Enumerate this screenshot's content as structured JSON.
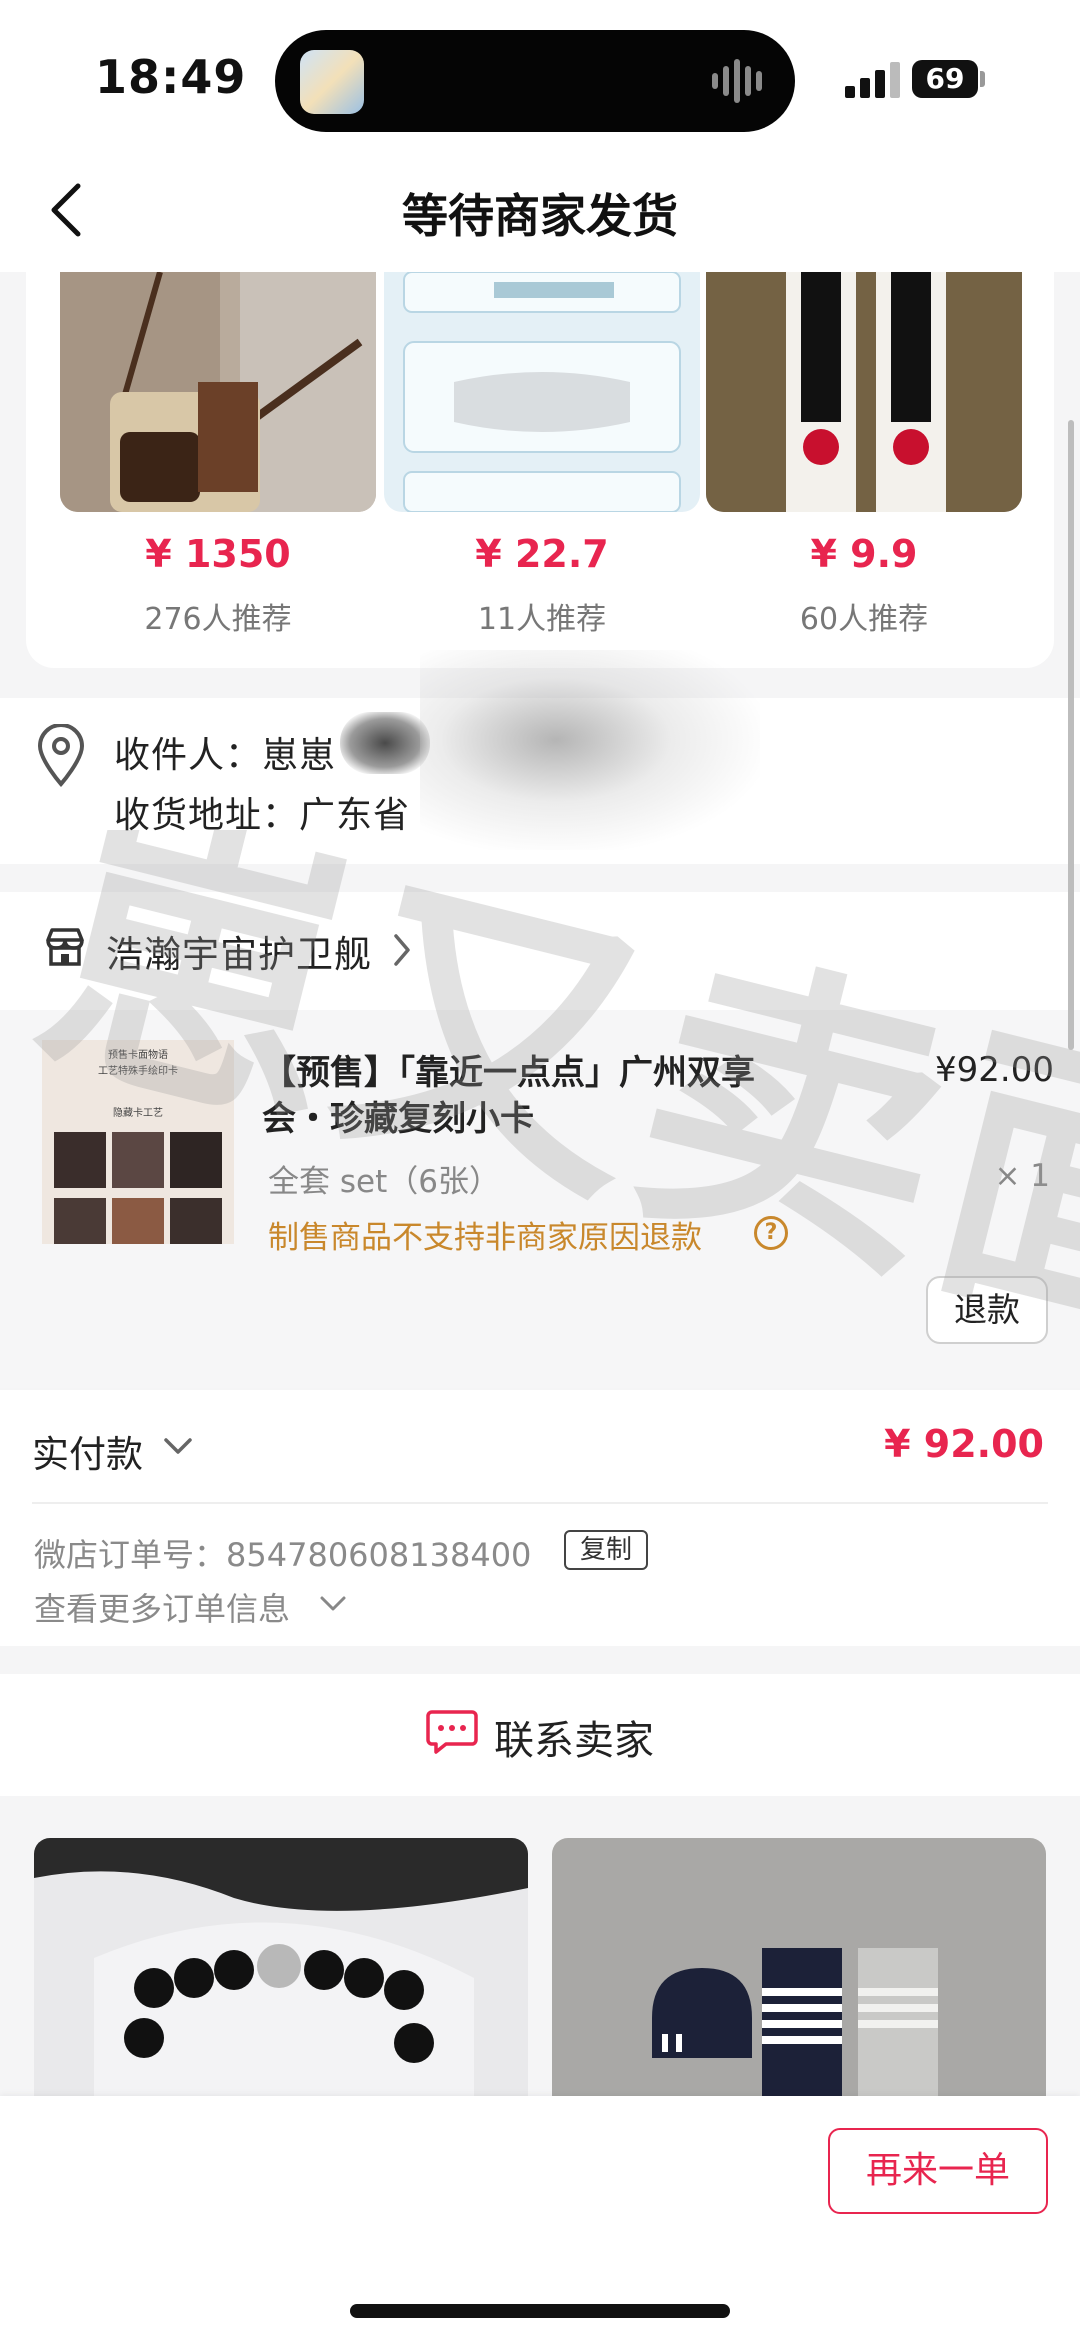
{
  "status_bar": {
    "time": "18:49",
    "battery": "69"
  },
  "nav": {
    "title": "等待商家发货"
  },
  "recommend": [
    {
      "price": "¥ 1350",
      "count": "276人推荐"
    },
    {
      "price": "¥ 22.7",
      "count": "11人推荐"
    },
    {
      "price": "¥ 9.9",
      "count": "60人推荐"
    }
  ],
  "address": {
    "recipient_label": "收件人：",
    "recipient_name": "崽崽",
    "address_label": "收货地址：",
    "address_value": "广东省"
  },
  "shop": {
    "name": "浩瀚宇宙护卫舰"
  },
  "item": {
    "title": "【预售】「靠近一点点」广州双享会・珍藏复刻小卡",
    "price": "¥92.00",
    "spec": "全套 set（6张）",
    "qty": "× 1",
    "note": "制售商品不支持非商家原因退款",
    "refund_label": "退款",
    "thumb_text_1": "预售卡面物语",
    "thumb_text_2": "工艺特殊手绘印卡",
    "thumb_text_3": "隐藏卡工艺"
  },
  "payment": {
    "label": "实付款",
    "amount": "¥ 92.00",
    "order_no_label": "微店订单号：",
    "order_no": "854780608138400",
    "copy_label": "复制",
    "more_info": "查看更多订单信息"
  },
  "contact": {
    "label": "联系卖家"
  },
  "bottom": {
    "reorder_label": "再来一单"
  },
  "watermark": {
    "text": "崽又卖面"
  },
  "colors": {
    "accent": "#e8254f",
    "warning": "#c9882c"
  }
}
